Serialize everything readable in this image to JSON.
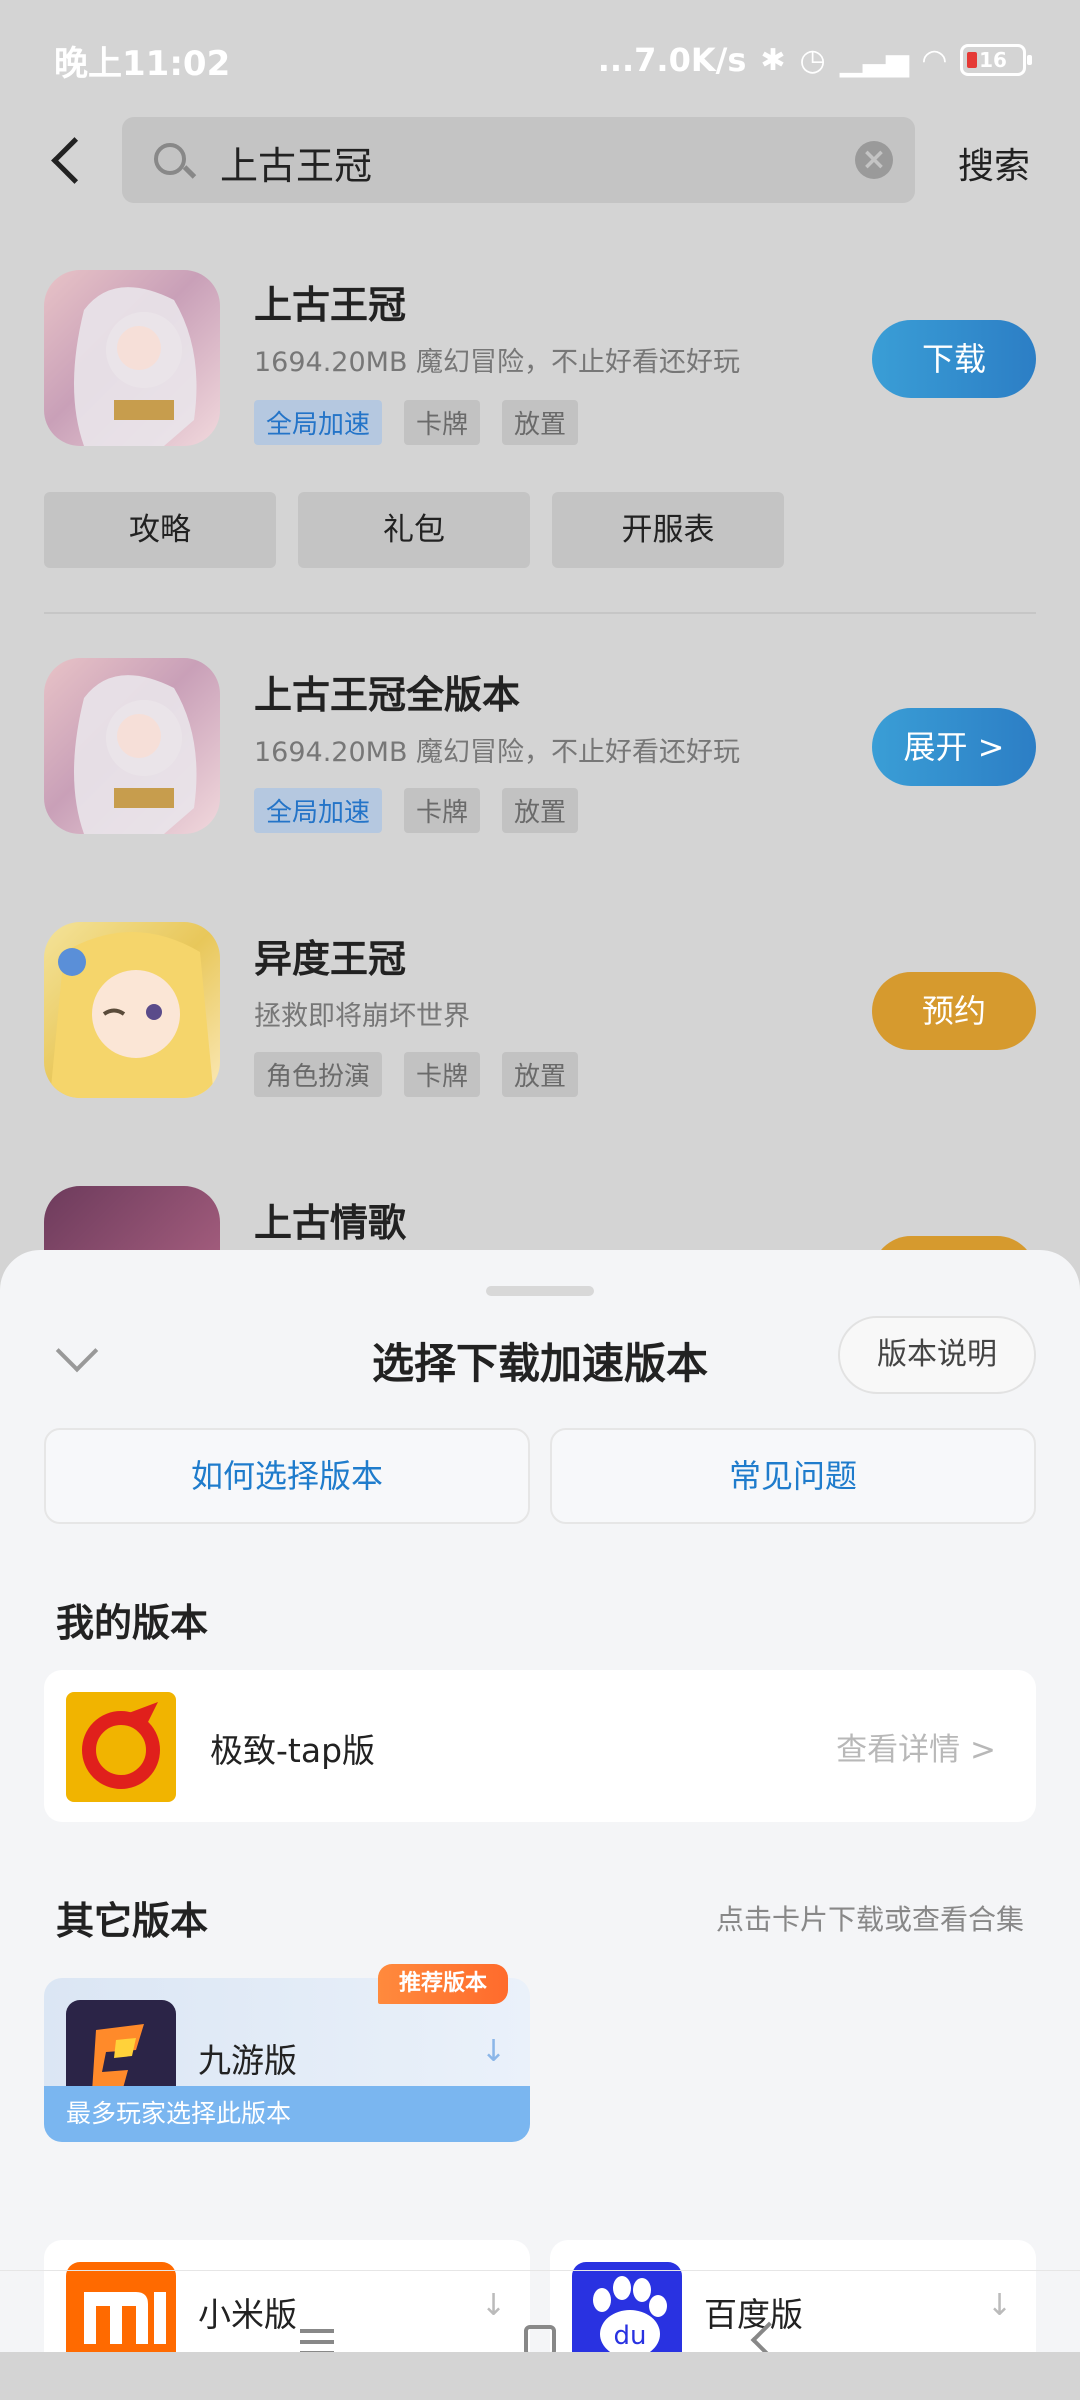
{
  "status_bar": {
    "time": "晚上11:02",
    "network_speed": "...7.0K/s",
    "battery": "16"
  },
  "search": {
    "query": "上古王冠",
    "search_button": "搜索"
  },
  "apps": [
    {
      "title": "上古王冠",
      "desc": "1694.20MB  魔幻冒险，不止好看还好玩",
      "tags": [
        "全局加速",
        "卡牌",
        "放置"
      ],
      "action": "下载"
    },
    {
      "title": "上古王冠全版本",
      "desc": "1694.20MB  魔幻冒险，不止好看还好玩",
      "tags": [
        "全局加速",
        "卡牌",
        "放置"
      ],
      "action": "展开 >"
    },
    {
      "title": "异度王冠",
      "desc": "拯救即将崩坏世界",
      "tags": [
        "角色扮演",
        "卡牌",
        "放置"
      ],
      "action": "预约"
    },
    {
      "title": "上古情歌"
    }
  ],
  "quick_links": [
    "攻略",
    "礼包",
    "开服表"
  ],
  "sheet": {
    "title": "选择下载加速版本",
    "version_info_button": "版本说明",
    "how_to_choose": "如何选择版本",
    "faq": "常见问题",
    "my_version_title": "我的版本",
    "my_version": {
      "name": "极致-tap版",
      "detail": "查看详情 >"
    },
    "other_versions_title": "其它版本",
    "other_versions_hint": "点击卡片下载或查看合集",
    "featured": {
      "badge": "推荐版本",
      "name": "九游版",
      "bar": "最多玩家选择此版本"
    },
    "versions": [
      {
        "name": "小米版",
        "icon_text": "mi"
      },
      {
        "name": "百度版",
        "icon_text": "du"
      }
    ]
  },
  "colors": {
    "accent_blue": "#2c7ec5",
    "accent_orange": "#d69a2e",
    "link_blue": "#1f7ccc"
  }
}
